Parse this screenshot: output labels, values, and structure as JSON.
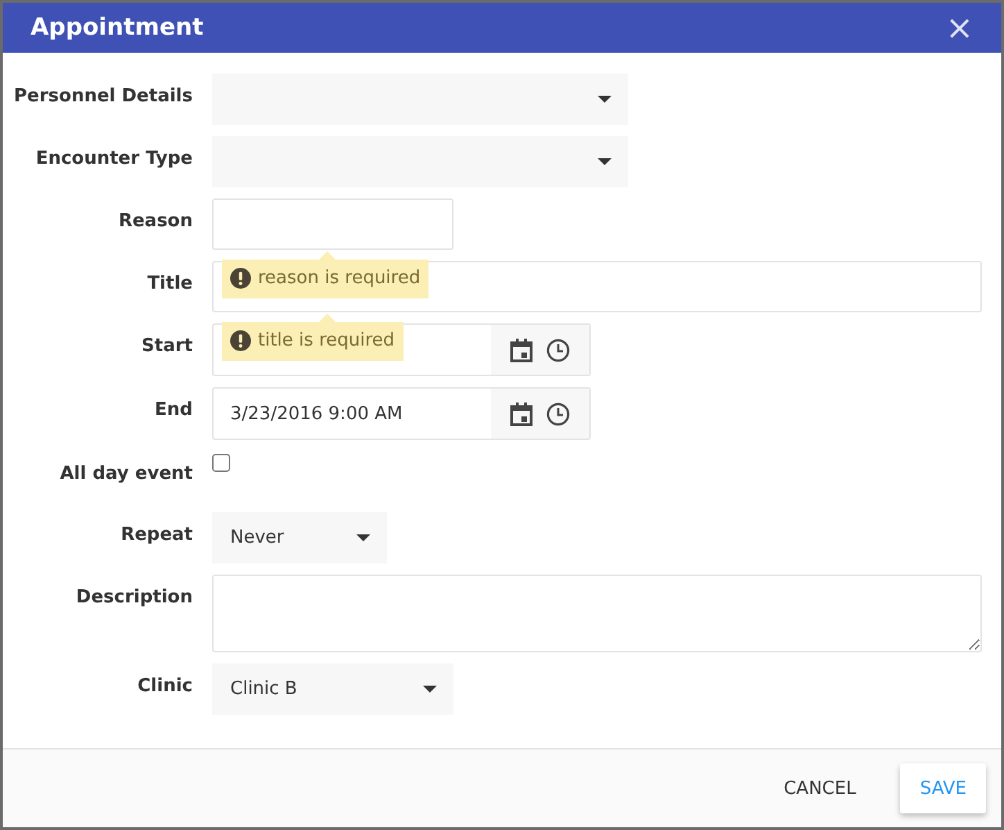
{
  "window": {
    "title": "Appointment",
    "close": "×"
  },
  "fields": [
    {
      "label": "Personnel Details",
      "kind": "dropdown"
    },
    {
      "label": "Encounter Type",
      "kind": "dropdown"
    },
    {
      "label": "Reason",
      "kind": "text",
      "error": "reason is required"
    },
    {
      "label": "Title",
      "kind": "text",
      "error": "title is required"
    },
    {
      "label": "Start",
      "kind": "datetime"
    },
    {
      "label": "End",
      "kind": "datetime",
      "value": "3/23/2016 9:00 AM"
    },
    {
      "label": "All day event",
      "kind": "checkbox",
      "checked": false
    },
    {
      "label": "Repeat",
      "kind": "dropdown",
      "value": "Never"
    },
    {
      "label": "Description",
      "kind": "textarea"
    },
    {
      "label": "Clinic",
      "kind": "dropdown",
      "value": "Clinic B"
    }
  ],
  "buttons": [
    {
      "label": "CANCEL",
      "kind": "flat"
    },
    {
      "label": "SAVE",
      "kind": "raised"
    }
  ]
}
